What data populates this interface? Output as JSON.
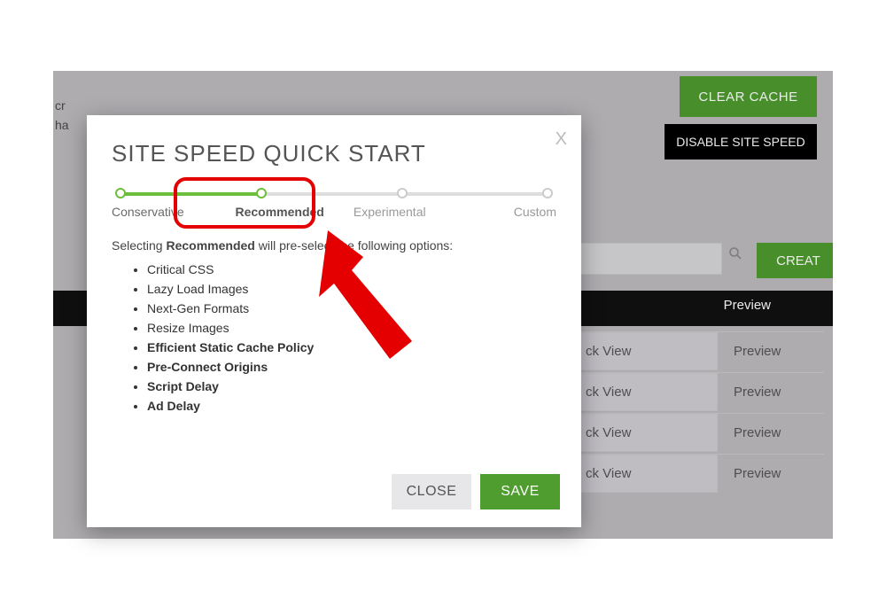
{
  "top": {
    "clear_cache": "CLEAR CACHE",
    "disable": "DISABLE SITE SPEED",
    "create": "CREAT"
  },
  "left_text": "cr\nha",
  "table": {
    "header_preview": "Preview",
    "quick_view": "ck View",
    "preview": "Preview"
  },
  "modal": {
    "title": "SITE SPEED QUICK START",
    "close_x": "X",
    "steps": {
      "conservative": "Conservative",
      "recommended": "Recommended",
      "experimental": "Experimental",
      "custom": "Custom",
      "selected_index": 1
    },
    "desc_pre": "Selecting ",
    "desc_bold": "Recommended",
    "desc_post": " will pre-select the following options:",
    "options": [
      {
        "label": "Critical CSS",
        "bold": false
      },
      {
        "label": "Lazy Load Images",
        "bold": false
      },
      {
        "label": "Next-Gen Formats",
        "bold": false
      },
      {
        "label": "Resize Images",
        "bold": false
      },
      {
        "label": "Efficient Static Cache Policy",
        "bold": true
      },
      {
        "label": "Pre-Connect Origins",
        "bold": true
      },
      {
        "label": "Script Delay",
        "bold": true
      },
      {
        "label": "Ad Delay",
        "bold": true
      }
    ],
    "close_btn": "CLOSE",
    "save_btn": "SAVE"
  }
}
